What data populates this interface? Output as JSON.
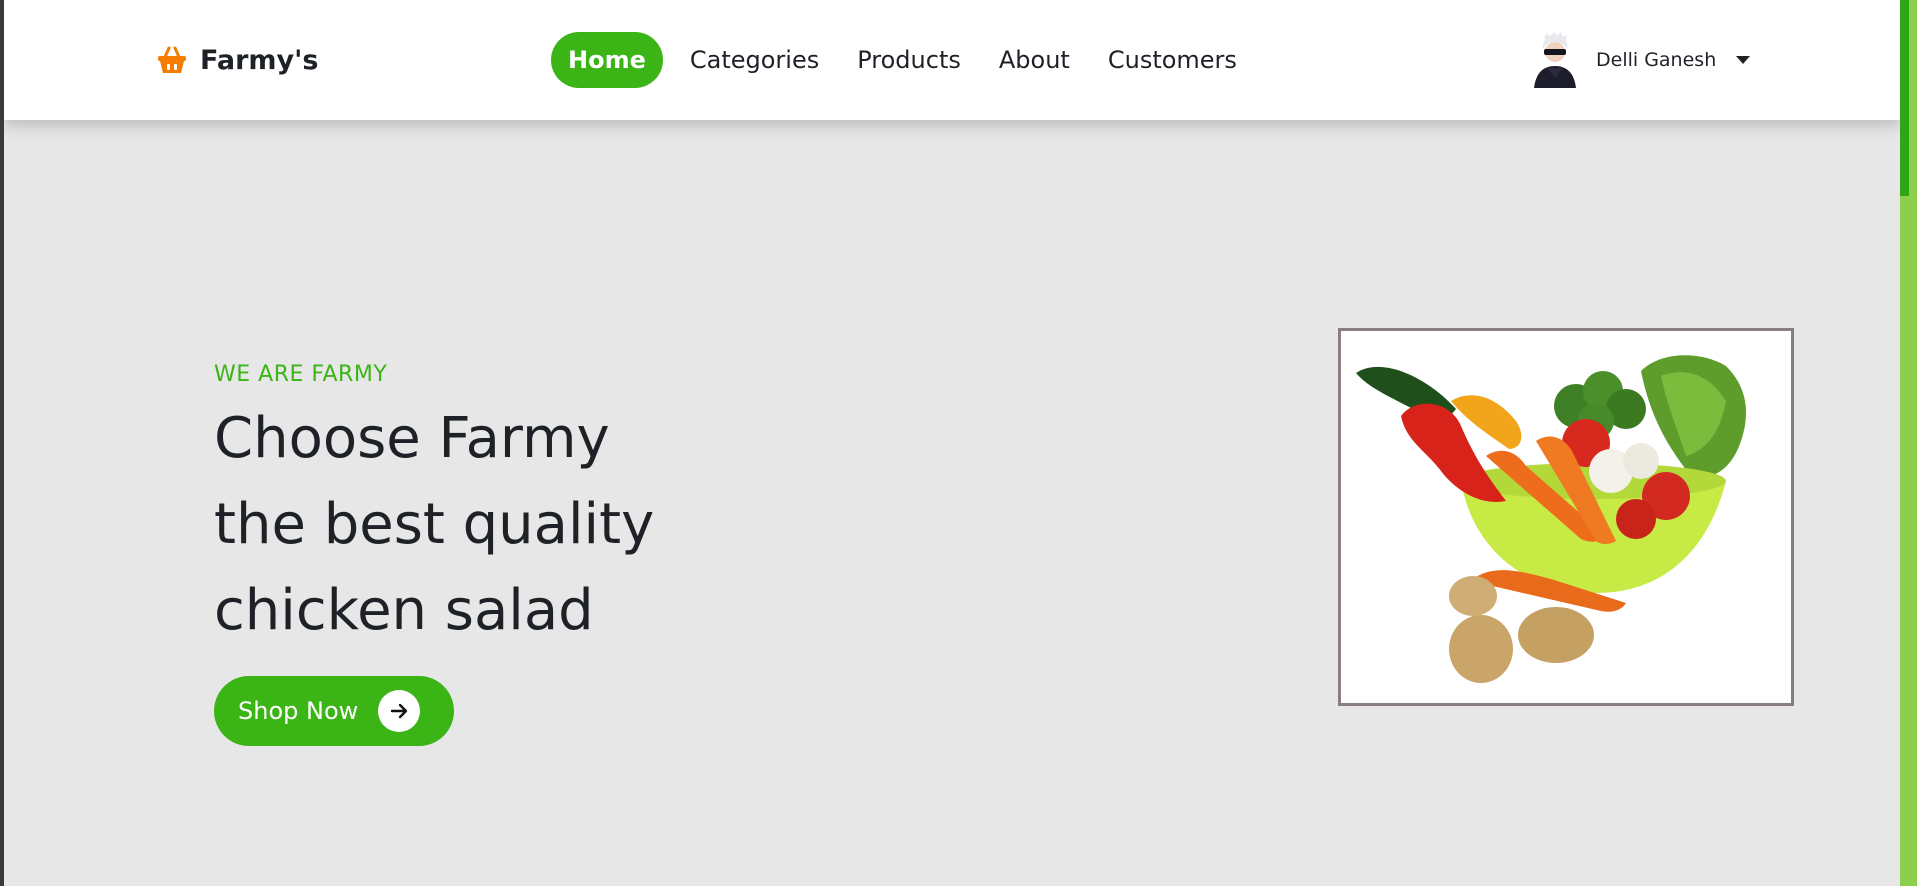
{
  "brand": {
    "name": "Farmy's",
    "icon": "basket-icon",
    "icon_color": "#f57c00"
  },
  "nav": {
    "items": [
      "Home",
      "Categories",
      "Products",
      "About",
      "Customers"
    ],
    "active": "Home",
    "accent_color": "#3bb515"
  },
  "user": {
    "name": "Delli Ganesh",
    "avatar": "user-avatar",
    "menu_icon": "caret-down-icon"
  },
  "hero": {
    "eyebrow": "WE ARE FARMY",
    "title_lines": [
      "Choose Farmy",
      "the best quality",
      "chicken salad"
    ],
    "cta_label": "Shop Now",
    "cta_icon": "arrow-right-icon",
    "image": "vegetable-bowl-image"
  },
  "colors": {
    "page_background": "#e7e7e7",
    "header_background": "#ffffff",
    "primary_green": "#3bb515",
    "text_dark": "#1e2227"
  }
}
